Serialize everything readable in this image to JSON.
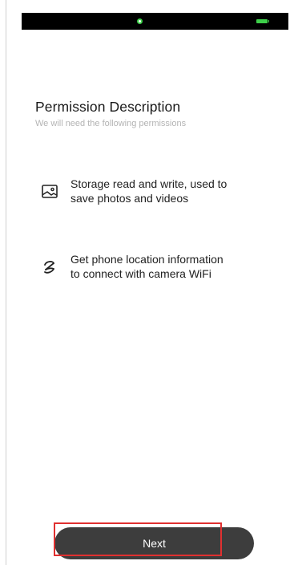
{
  "page": {
    "title": "Permission Description",
    "subtitle": "We will need the following permissions"
  },
  "permissions": [
    {
      "icon": "image-icon",
      "text": "Storage read and write, used to save photos and videos"
    },
    {
      "icon": "location-icon",
      "text": "Get phone location information to connect with camera WiFi"
    }
  ],
  "actions": {
    "next_label": "Next"
  },
  "colors": {
    "button_bg": "#3d3d3d",
    "highlight": "#e03030",
    "status_accent": "#3ecf4a"
  }
}
